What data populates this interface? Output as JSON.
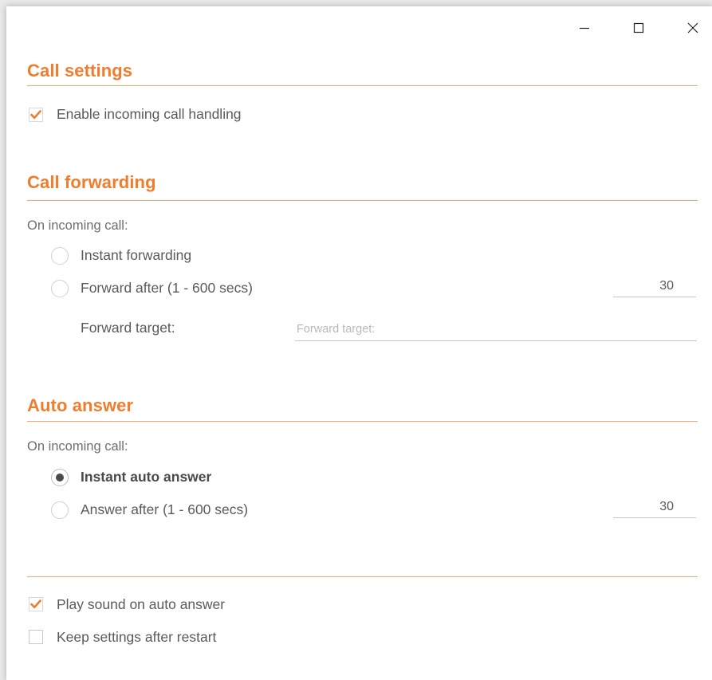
{
  "window": {
    "controls": {
      "minimize_icon": "minimize-icon",
      "maximize_icon": "maximize-icon",
      "close_icon": "close-icon"
    }
  },
  "call_settings": {
    "title": "Call settings",
    "enable_incoming": {
      "label": "Enable incoming call handling",
      "checked": true
    }
  },
  "call_forwarding": {
    "title": "Call forwarding",
    "prompt": "On incoming call:",
    "options": [
      {
        "label": "Instant forwarding",
        "selected": false
      },
      {
        "label": "Forward after (1 - 600 secs)",
        "selected": false
      }
    ],
    "forward_after_value": "30",
    "forward_target_label": "Forward target:",
    "forward_target_placeholder": "Forward target:"
  },
  "auto_answer": {
    "title": "Auto answer",
    "prompt": "On incoming call:",
    "options": [
      {
        "label": "Instant auto answer",
        "selected": true
      },
      {
        "label": "Answer after (1 - 600 secs)",
        "selected": false
      }
    ],
    "answer_after_value": "30"
  },
  "footer": {
    "play_sound": {
      "label": "Play sound on auto answer",
      "checked": true
    },
    "keep_settings": {
      "label": "Keep settings after restart",
      "checked": false
    }
  },
  "colors": {
    "accent": "#ef7d30",
    "accent_line": "#f0a572",
    "text": "#5a5a5a"
  }
}
